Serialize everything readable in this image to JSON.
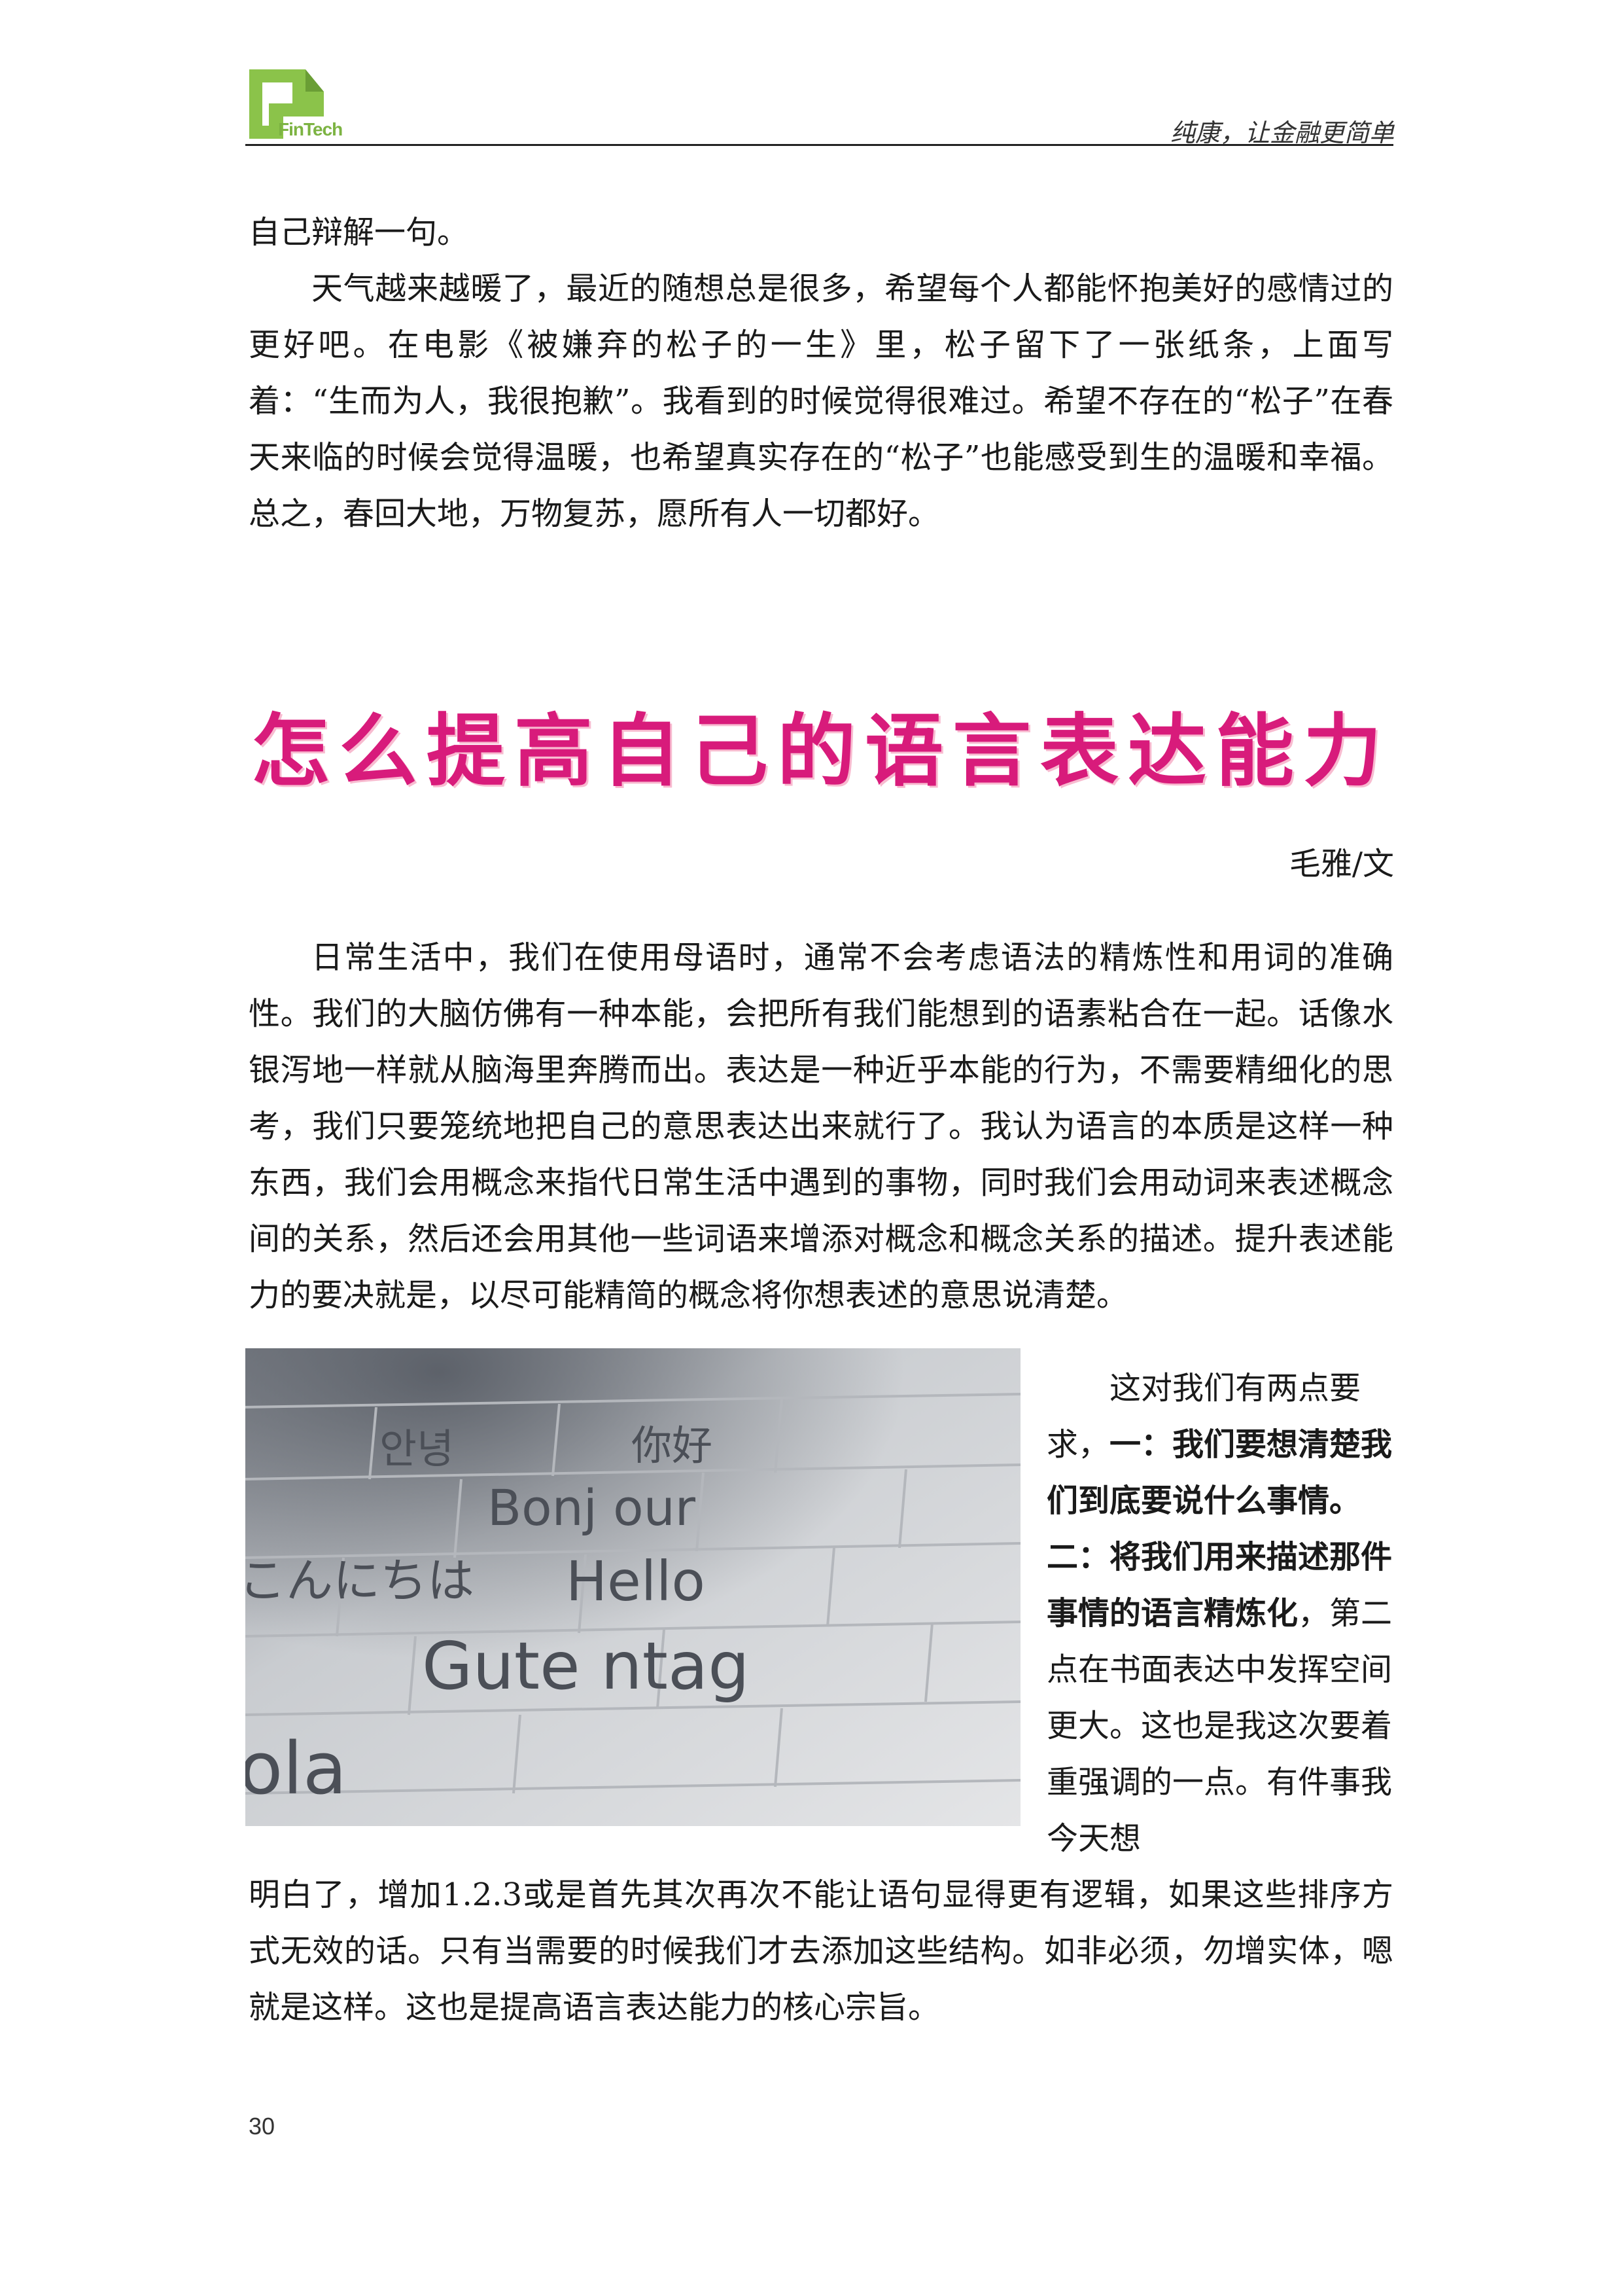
{
  "header": {
    "logo_text": "FinTech",
    "slogan": "纯康，让金融更简单"
  },
  "intro": {
    "line1": "自己辩解一句。",
    "paragraph": "天气越来越暖了，最近的随想总是很多，希望每个人都能怀抱美好的感情过的更好吧。在电影《被嫌弃的松子的一生》里，松子留下了一张纸条，上面写着：“生而为人，我很抱歉”。我看到的时候觉得很难过。希望不存在的“松子”在春天来临的时候会觉得温暖，也希望真实存在的“松子”也能感受到生的温暖和幸福。总之，春回大地，万物复苏，愿所有人一切都好。"
  },
  "article": {
    "title": "怎么提高自己的语言表达能力",
    "author": "毛雅/文",
    "paragraph1": "日常生活中，我们在使用母语时，通常不会考虑语法的精炼性和用词的准确性。我们的大脑仿佛有一种本能，会把所有我们能想到的语素粘合在一起。话像水银泻地一样就从脑海里奔腾而出。表达是一种近乎本能的行为，不需要精细化的思考，我们只要笼统地把自己的意思表达出来就行了。我认为语言的本质是这样一种东西，我们会用概念来指代日常生活中遇到的事物，同时我们会用动词来表述概念间的关系，然后还会用其他一些词语来增添对概念和概念关系的描述。提升表述能力的要决就是，以尽可能精简的概念将你想表述的意思说清楚。",
    "side_intro": "这对我们有两点要求，",
    "side_bold": "一：我们要想清楚我们到底要说什么事情。二：将我们用来描述那件事情的语言精炼化",
    "side_rest": "，第二点在书面表达中发挥空间更大。这也是我这次要着重强调的一点。有件事我今天想",
    "paragraph_end": "明白了，增加1.2.3或是首先其次再次不能让语句显得更有逻辑，如果这些排序方式无效的话。只有当需要的时候我们才去添加这些结构。如非必须，勿增实体，嗯就是这样。这也是提高语言表达能力的核心宗旨。"
  },
  "photo": {
    "words": [
      "안녕",
      "你好",
      "Bonj our",
      "こんにちは",
      "Hello",
      "Gute ntag",
      "ola"
    ]
  },
  "page_number": "30",
  "colors": {
    "title": "#d81b7b",
    "logo": "#7cb342"
  }
}
